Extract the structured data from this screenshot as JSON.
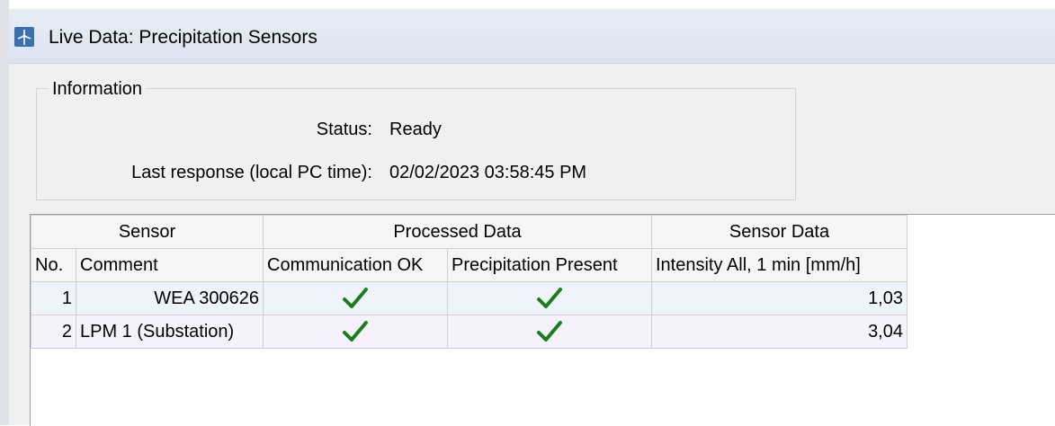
{
  "window": {
    "title": "Live Data: Precipitation Sensors",
    "icon": "wind-turbine-icon"
  },
  "information": {
    "group_title": "Information",
    "status_label": "Status:",
    "status_value": "Ready",
    "last_response_label": "Last response (local PC time):",
    "last_response_value": "02/02/2023 03:58:45 PM"
  },
  "table": {
    "group_headers": [
      "Sensor",
      "Processed Data",
      "Sensor Data"
    ],
    "columns": [
      "No.",
      "Comment",
      "Communication OK",
      "Precipitation Present",
      "Intensity All, 1 min [mm/h]"
    ],
    "rows": [
      {
        "no": "1",
        "comment": "WEA 300626",
        "communication_ok": true,
        "precipitation_present": true,
        "intensity": "1,03"
      },
      {
        "no": "2",
        "comment": "LPM 1 (Substation)",
        "communication_ok": true,
        "precipitation_present": true,
        "intensity": "3,04"
      }
    ]
  },
  "colors": {
    "check": "#1a7f1a",
    "title_bar": "#dde6f1"
  }
}
